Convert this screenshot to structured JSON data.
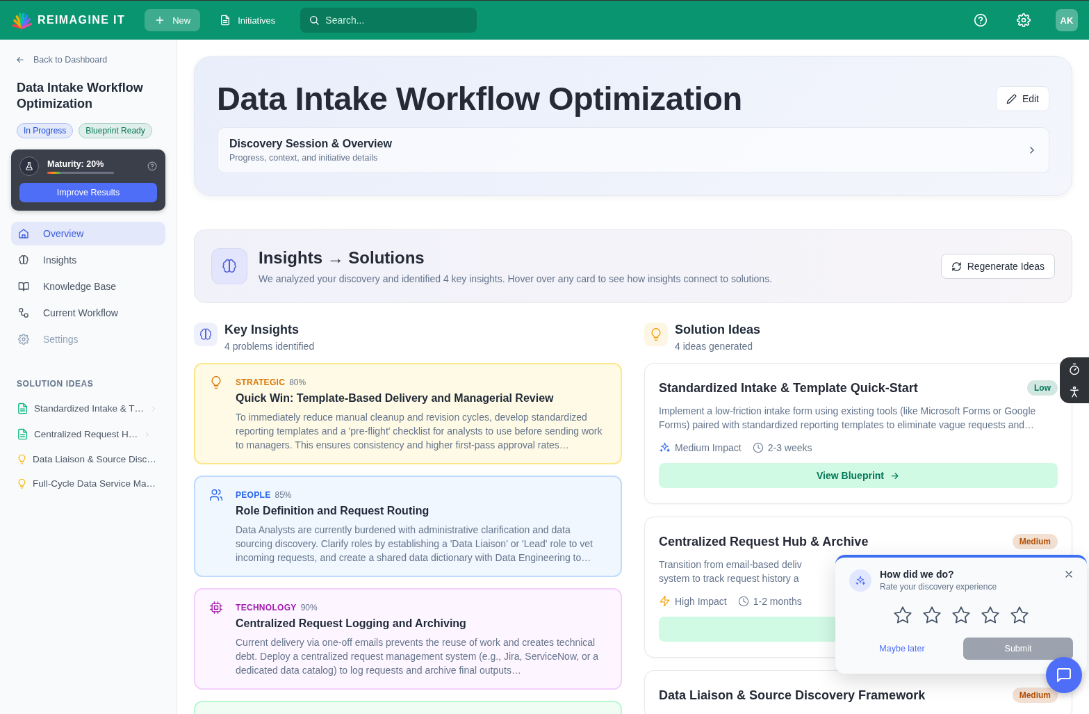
{
  "topbar": {
    "brand": "REIMAGINE IT",
    "new_button": "New",
    "nav_link": "Initiatives",
    "search": {
      "placeholder": "Search..."
    },
    "avatar": "AK"
  },
  "sidebar": {
    "back_link": "Back to Dashboard",
    "title": "Data Intake Workflow Optimization",
    "badges": [
      {
        "label": "In Progress",
        "color": "#1d4ed8"
      },
      {
        "label": "Blueprint Ready",
        "color": "#047857"
      }
    ],
    "maturity": {
      "label": "Maturity: 20%",
      "level": 0.2,
      "button": "Improve Results"
    },
    "nav": [
      {
        "kind": "home",
        "label": "Overview",
        "selected": true,
        "disabled": false
      },
      {
        "kind": "brain",
        "label": "Insights",
        "selected": false,
        "disabled": false
      },
      {
        "kind": "book",
        "label": "Knowledge Base",
        "selected": false,
        "disabled": false
      },
      {
        "kind": "workflow",
        "label": "Current Workflow",
        "selected": false,
        "disabled": false
      },
      {
        "kind": "gear",
        "label": "Settings",
        "selected": false,
        "disabled": true
      }
    ],
    "section_title": "SOLUTION IDEAS",
    "ideas": [
      {
        "kind": "blueprint",
        "label": "Standardized Intake & T…"
      },
      {
        "kind": "blueprint",
        "label": "Centralized Request H…"
      },
      {
        "kind": "idea",
        "label": "Data Liaison & Source Disc…"
      },
      {
        "kind": "idea",
        "label": "Full-Cycle Data Service Ma…"
      }
    ]
  },
  "header": {
    "title": "Data Intake Workflow Optimization",
    "edit_button": "Edit",
    "discovery": {
      "title": "Discovery Session & Overview",
      "subtitle": "Progress, context, and initiative details"
    }
  },
  "banner": {
    "title": "Insights → Solutions",
    "subtitle": "We analyzed your discovery and identified 4 key insights. Hover over any card to see how insights connect to solutions.",
    "button": "Regenerate Ideas"
  },
  "key_insights": {
    "title": "Key Insights",
    "subtitle": "4 problems identified",
    "cards": [
      {
        "kind": "bulb",
        "color": "#fde68a",
        "category": "STRATEGIC",
        "confidence": "80%",
        "title": "Quick Win: Template-Based Delivery and Managerial Review",
        "description": "To immediately reduce manual cleanup and revision cycles, develop standardized reporting templates and a 'pre-flight' checklist for analysts to use before sending work to managers. This ensures consistency and higher first-pass approval rates…"
      },
      {
        "kind": "people",
        "color": "#bfdbfe",
        "category": "PEOPLE",
        "confidence": "85%",
        "title": "Role Definition and Request Routing",
        "description": "Data Analysts are currently burdened with administrative clarification and data sourcing discovery. Clarify roles by establishing a 'Data Liaison' or 'Lead' role to vet incoming requests, and create a shared data dictionary with Data Engineering to…"
      },
      {
        "kind": "chip",
        "color": "#f5d0fe",
        "category": "TECHNOLOGY",
        "confidence": "90%",
        "title": "Centralized Request Logging and Archiving",
        "description": "Current delivery via one-off emails prevents the reuse of work and creates technical debt. Deploy a centralized request management system (e.g., Jira, ServiceNow, or a dedicated data catalog) to log requests and archive final outputs…"
      },
      {
        "color": "#bbf7d0"
      }
    ]
  },
  "solution_ideas": {
    "title": "Solution Ideas",
    "subtitle": "4 ideas generated",
    "cards": [
      {
        "title": "Standardized Intake & Template Quick-Start",
        "badge": {
          "label": "Low",
          "color": "#047857"
        },
        "description": "Implement a low-friction intake form using existing tools (like Microsoft Forms or Google Forms) paired with standardized reporting templates to eliminate vague requests and…",
        "impact": {
          "kind": "sparkle",
          "label": "Medium Impact"
        },
        "duration": "2-3 weeks",
        "button": "View Blueprint"
      },
      {
        "title": "Centralized Request Hub & Archive",
        "badge": {
          "label": "Medium",
          "color": "#b45309"
        },
        "description_lines": [
          "Transition from email-based deliv",
          "system to track request history a"
        ],
        "impact": {
          "kind": "bolt",
          "label": "High Impact"
        },
        "duration": "1-2 months",
        "feedback": true
      },
      {
        "title": "Data Liaison & Source Discovery Framework",
        "badge": {
          "label": "Medium",
          "color": "#b45309"
        }
      }
    ]
  },
  "feedback": {
    "title": "How did we do?",
    "subtitle": "Rate your discovery experience",
    "stars": 0,
    "later_button": "Maybe later",
    "submit_button": {
      "label": "Submit",
      "disabled": true
    }
  }
}
